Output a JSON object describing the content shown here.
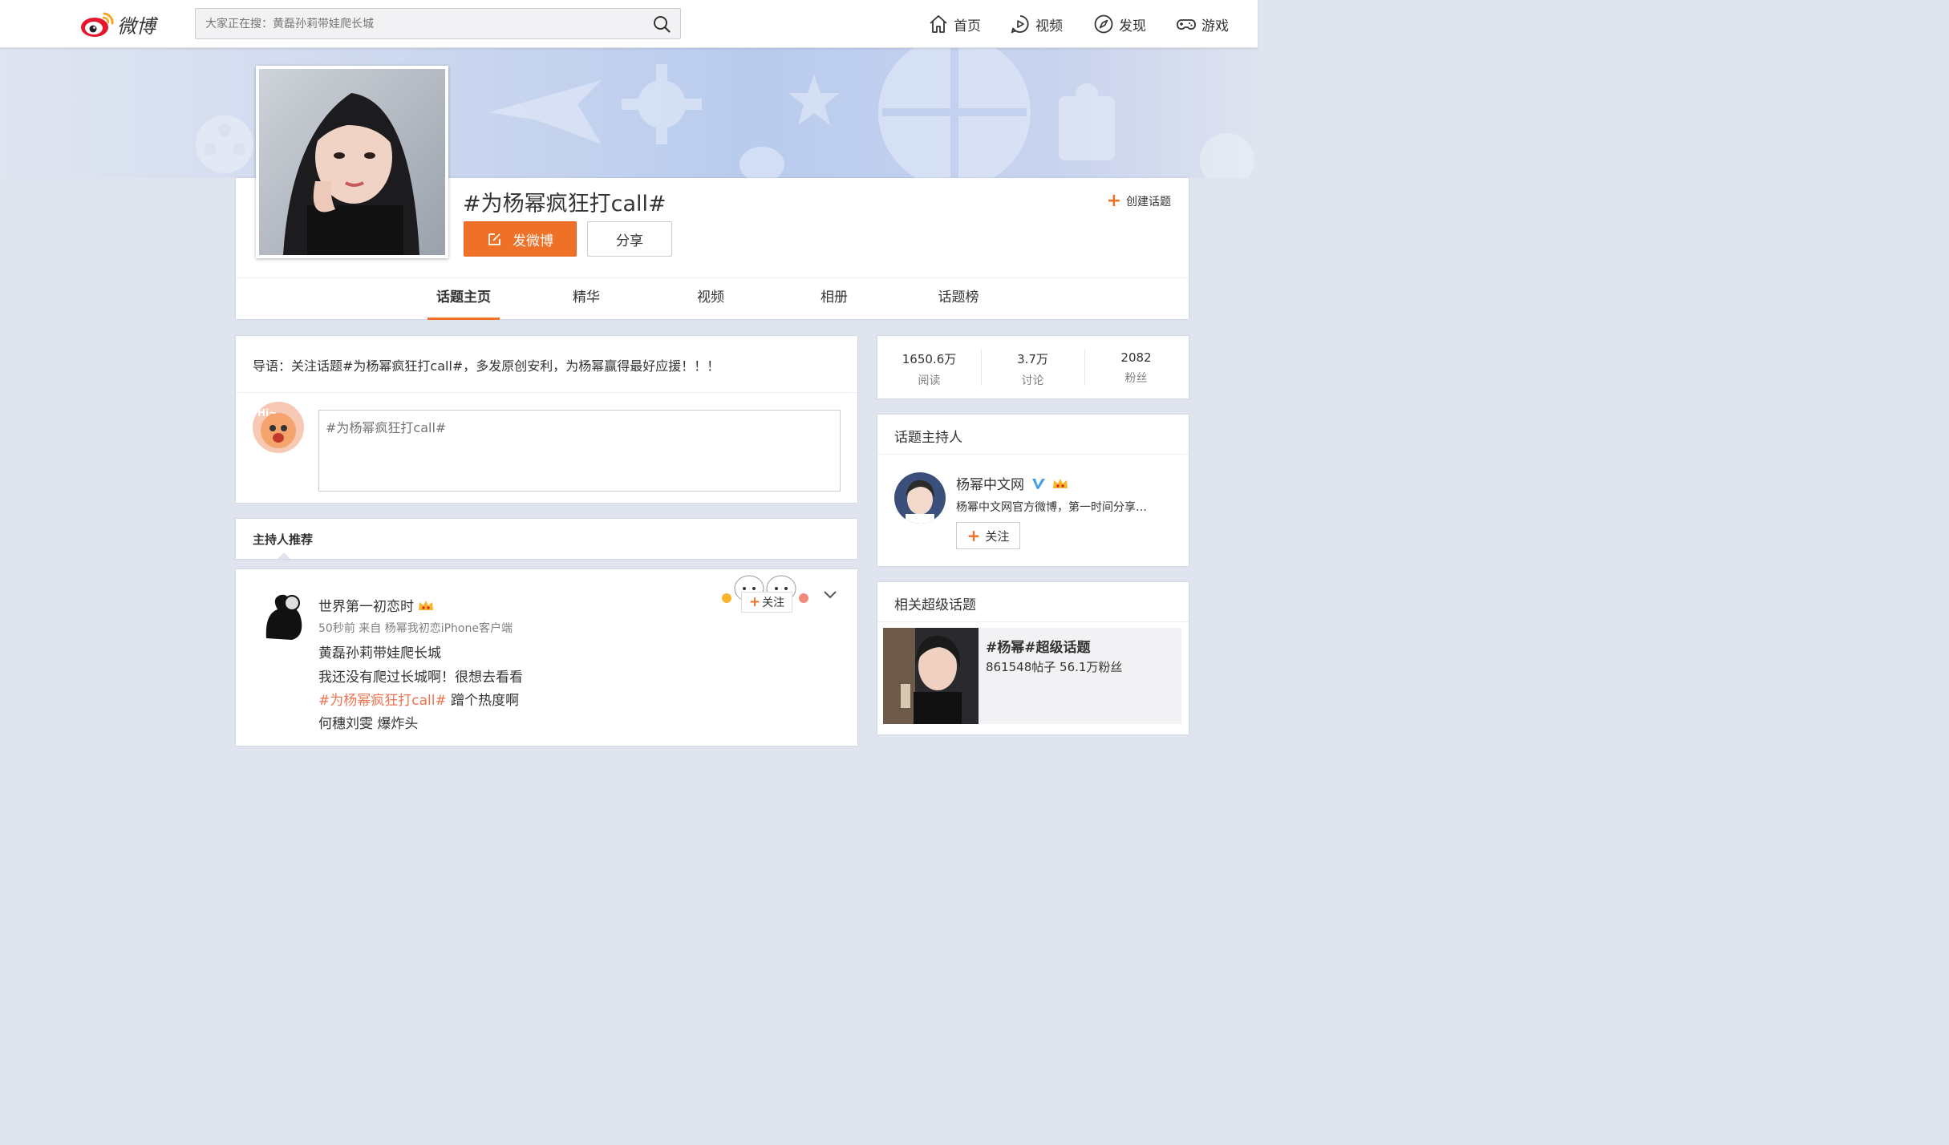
{
  "header": {
    "logo_text": "微博",
    "search_placeholder": "大家正在搜：黄磊孙莉带娃爬长城",
    "nav": [
      {
        "label": "首页",
        "icon": "home-icon"
      },
      {
        "label": "视频",
        "icon": "video-icon"
      },
      {
        "label": "发现",
        "icon": "compass-icon"
      },
      {
        "label": "游戏",
        "icon": "gamepad-icon"
      }
    ]
  },
  "topic": {
    "title": "#为杨幂疯狂打call#",
    "post_button": "发微博",
    "share_button": "分享",
    "create_topic": "创建话题",
    "tabs": [
      "话题主页",
      "精华",
      "视频",
      "相册",
      "话题榜"
    ],
    "active_tab": "话题主页"
  },
  "intro": {
    "text": "导语：关注话题#为杨幂疯狂打call#，多发原创安利，为杨幂赢得最好应援！！！",
    "composer_placeholder": "#为杨幂疯狂打call#"
  },
  "host_recommend": {
    "title": "主持人推荐"
  },
  "feed": {
    "name": "世界第一初恋时",
    "meta": "50秒前 来自 杨幂我初恋iPhone客户端",
    "lines": [
      "黄磊孙莉带娃爬长城",
      "我还没有爬过长城啊！很想去看看"
    ],
    "hashtag": "#为杨幂疯狂打call#",
    "hashtag_suffix": " 蹭个热度啊",
    "last_line": "何穗刘雯 爆炸头",
    "follow_label": "关注"
  },
  "stats": [
    {
      "value": "1650.6万",
      "label": "阅读"
    },
    {
      "value": "3.7万",
      "label": "讨论"
    },
    {
      "value": "2082",
      "label": "粉丝"
    }
  ],
  "host": {
    "section_title": "话题主持人",
    "name": "杨幂中文网",
    "desc": "杨幂中文网官方微博，第一时间分享…",
    "follow_label": "关注"
  },
  "super_topic": {
    "section_title": "相关超级话题",
    "title": "#杨幂#超级话题",
    "sub": "861548帖子 56.1万粉丝"
  },
  "colors": {
    "accent": "#ee7127",
    "hashtag": "#eb7350",
    "verified": "#4a9ee8",
    "page_bg": "#dfe4ee"
  }
}
